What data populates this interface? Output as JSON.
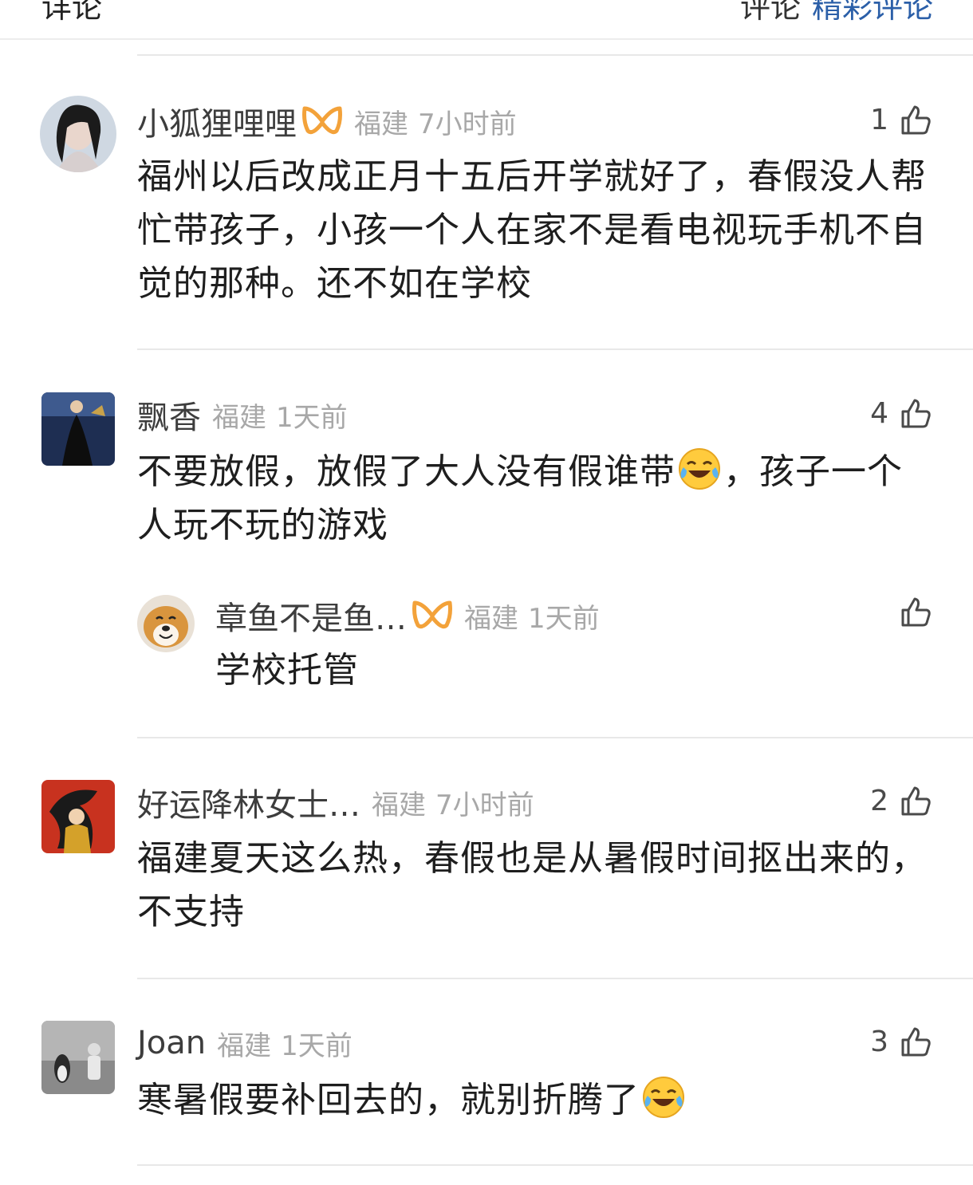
{
  "top_bar": {
    "left_text": "详论",
    "right_grey": "评论",
    "right_blue": "精彩评论"
  },
  "comments": [
    {
      "username": "小狐狸哩哩",
      "vip": true,
      "location": "福建",
      "time": "7小时前",
      "likes": "1",
      "text": "福州以后改成正月十五后开学就好了，春假没人帮忙带孩子，小孩一个人在家不是看电视玩手机不自觉的那种。还不如在学校",
      "avatar_colors": [
        "#c9d3de",
        "#2a2a2a"
      ]
    },
    {
      "username": "飘香",
      "vip": false,
      "location": "福建",
      "time": "1天前",
      "likes": "4",
      "text_a": "不要放假，放假了大人没有假谁带",
      "text_b": "，孩子一个人玩不玩的游戏",
      "emoji": "laugh-cry-emoji"
    },
    {
      "username": "章鱼不是鱼…",
      "vip": true,
      "location": "福建",
      "time": "1天前",
      "likes": "",
      "text": "学校托管",
      "is_reply": true
    },
    {
      "username": "好运降林女士…",
      "vip": false,
      "location": "福建",
      "time": "7小时前",
      "likes": "2",
      "text": "福建夏天这么热，春假也是从暑假时间抠出来的，不支持"
    },
    {
      "username": "Joan",
      "vip": false,
      "location": "福建",
      "time": "1天前",
      "likes": "3",
      "text_a": "寒暑假要补回去的，就别折腾了",
      "emoji": "laugh-cry-emoji"
    }
  ],
  "colors": {
    "vip_badge": "#f3a23a",
    "meta_grey": "#a8a8a8",
    "link_blue": "#2b5fa8"
  }
}
